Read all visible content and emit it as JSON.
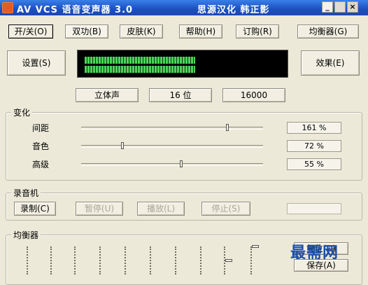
{
  "titlebar": {
    "app_title": "AV VCS 语音变声器 3.0",
    "subtitle": "思源汉化 韩正影",
    "minimize": "_",
    "close": "×"
  },
  "toolbar": {
    "items": [
      {
        "label": "开/关(O)"
      },
      {
        "label": "双功(B)"
      },
      {
        "label": "皮肤(K)"
      },
      {
        "label": "帮助(H)"
      },
      {
        "label": "订购(R)"
      },
      {
        "label": "均衡器(G)"
      }
    ]
  },
  "left_button": "设置(S)",
  "right_button": "效果(E)",
  "display": {
    "level_top_fraction": 1.0,
    "level_bottom_fraction": 1.0,
    "level_color": "#4bd45b"
  },
  "format": {
    "channels": "立体声",
    "bits": "16 位",
    "rate": "16000"
  },
  "change_group": {
    "title": "变化",
    "sliders": [
      {
        "label": "间距",
        "value_text": "161 %"
      },
      {
        "label": "音色",
        "value_text": "72 %"
      },
      {
        "label": "高级",
        "value_text": "55 %"
      }
    ]
  },
  "recorder_group": {
    "title": "录音机",
    "buttons": [
      {
        "label": "录制(C)"
      },
      {
        "label": "暂停(U)"
      },
      {
        "label": "播放(L)"
      },
      {
        "label": "停止(S)"
      }
    ]
  },
  "equalizer_group": {
    "title": "均衡器",
    "reset_button": "复位(D)",
    "save_button": "保存(A)"
  },
  "watermark": "最需网",
  "colors": {
    "titlebar": "#1a4fc0",
    "face": "#ece9d8",
    "display_bg": "#000000"
  }
}
